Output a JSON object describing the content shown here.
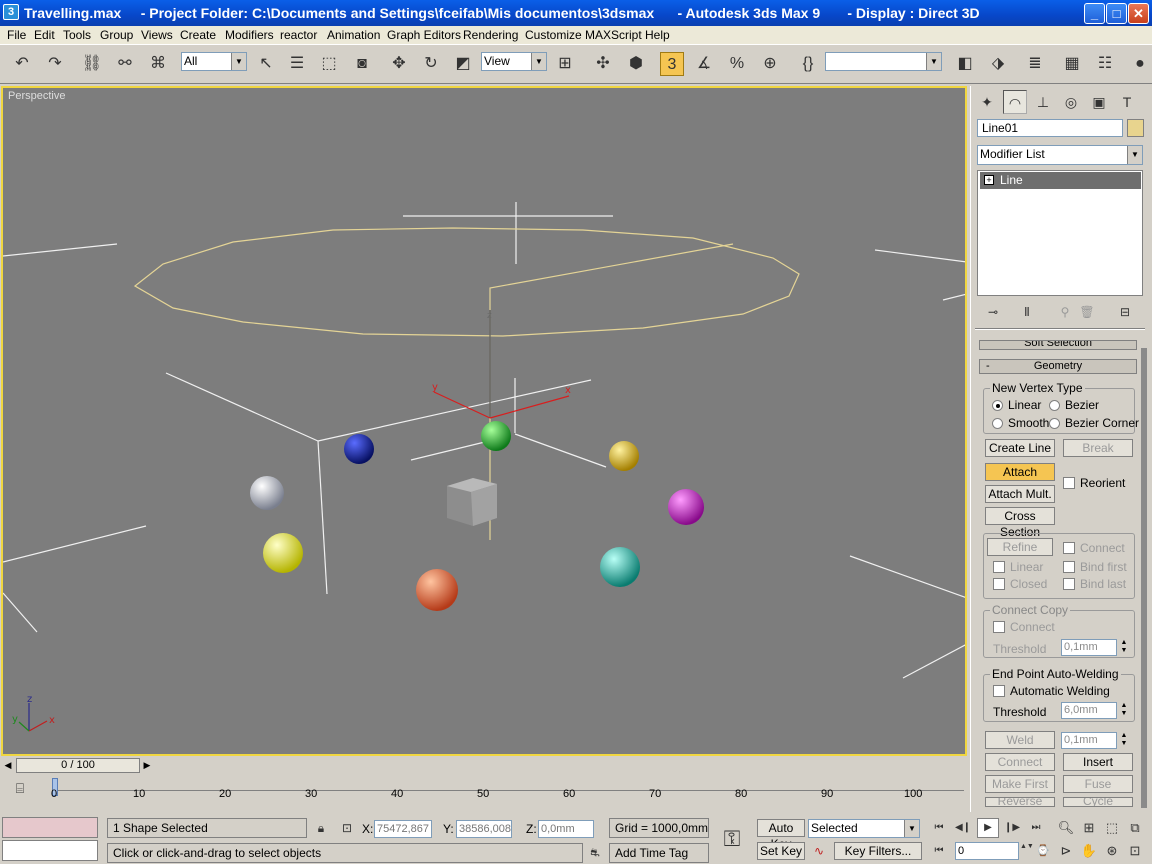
{
  "window": {
    "title": "Travelling.max     - Project Folder: C:\\Documents and Settings\\fceifab\\Mis documentos\\3dsmax      - Autodesk 3ds Max 9       - Display : Direct 3D",
    "app_icon": "3",
    "minimize": "_",
    "maximize": "□",
    "close": "✕"
  },
  "menu": [
    "File",
    "Edit",
    "Tools",
    "Group",
    "Views",
    "Create",
    "Modifiers",
    "reactor",
    "Animation",
    "Graph Editors",
    "Rendering",
    "Customize",
    "MAXScript",
    "Help"
  ],
  "toolbar": {
    "selection_filter": "All",
    "reference_coord": "View",
    "snap_label": "3",
    "named_selection": ""
  },
  "viewport": {
    "label": "Perspective",
    "gizmo_x": "x",
    "gizmo_y": "y",
    "gizmo_z": "z",
    "axis_x": "x",
    "axis_y": "y",
    "axis_z": "z"
  },
  "time_slider": {
    "label": "0 / 100",
    "ticks": [
      "0",
      "10",
      "20",
      "30",
      "40",
      "50",
      "60",
      "70",
      "80",
      "90",
      "100"
    ]
  },
  "status": {
    "selection": "1 Shape Selected",
    "prompt": "Click or click-and-drag to select objects",
    "x_label": "X:",
    "x_value": "75472,867",
    "y_label": "Y:",
    "y_value": "38586,008",
    "z_label": "Z:",
    "z_value": "0,0mm",
    "grid": "Grid = 1000,0mm",
    "add_time_tag": "Add Time Tag",
    "auto_key": "Auto Key",
    "set_key": "Set Key",
    "key_mode": "Selected",
    "key_filters": "Key Filters...",
    "frame": "0"
  },
  "panel": {
    "object_name": "Line01",
    "modifier_list": "Modifier List",
    "stack_item": "Line",
    "stack_plus": "+",
    "rollout_soft": "Soft Selection",
    "rollout_geometry": "Geometry",
    "rollout_geometry_sign": "-",
    "rollout_soft_sign": "+",
    "new_vertex_type": "New Vertex Type",
    "linear": "Linear",
    "bezier": "Bezier",
    "smooth": "Smooth",
    "bezier_corner": "Bezier Corner",
    "create_line": "Create Line",
    "break": "Break",
    "attach": "Attach",
    "reorient": "Reorient",
    "attach_mult": "Attach Mult.",
    "cross_section": "Cross Section",
    "refine": "Refine",
    "connect": "Connect",
    "linear2": "Linear",
    "bind_first": "Bind first",
    "closed": "Closed",
    "bind_last": "Bind last",
    "connect_copy": "Connect Copy",
    "connect2": "Connect",
    "threshold": "Threshold",
    "threshold_value": "0,1mm",
    "end_point": "End Point Auto-Welding",
    "automatic_welding": "Automatic Welding",
    "threshold2": "Threshold",
    "threshold2_value": "6,0mm",
    "weld": "Weld",
    "weld_value": "0,1mm",
    "connect3": "Connect",
    "insert": "Insert",
    "make_first": "Make First",
    "fuse": "Fuse",
    "reverse": "Reverse",
    "cycle": "Cycle"
  }
}
